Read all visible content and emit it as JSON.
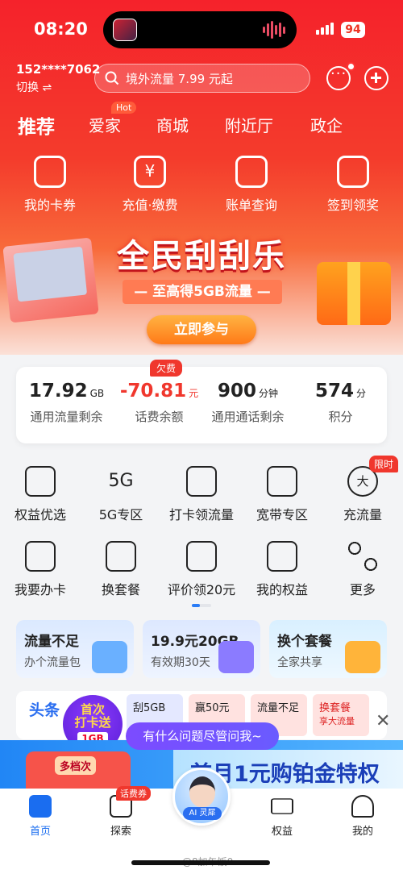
{
  "status": {
    "time": "08:20",
    "battery": "94"
  },
  "account": {
    "phone": "152****7062",
    "switch_label": "切换 ⇌"
  },
  "search": {
    "placeholder": "境外流量 7.99 元起"
  },
  "tabs": [
    {
      "label": "推荐"
    },
    {
      "label": "爱家",
      "badge": "Hot"
    },
    {
      "label": "商城"
    },
    {
      "label": "附近厅"
    },
    {
      "label": "政企"
    }
  ],
  "quick_actions": [
    {
      "label": "我的卡券",
      "icon": "coupon-icon"
    },
    {
      "label": "充值·缴费",
      "icon": "yen-icon"
    },
    {
      "label": "账单查询",
      "icon": "bill-search-icon"
    },
    {
      "label": "签到领奖",
      "icon": "calendar-check-icon"
    }
  ],
  "banner": {
    "title": "全民刮刮乐",
    "subtitle": "— 至高得5GB流量 —",
    "cta": "立即参与"
  },
  "stats": [
    {
      "value": "17.92",
      "unit": "GB",
      "label": "通用流量剩余"
    },
    {
      "value": "-70.81",
      "unit": "元",
      "label": "话费余额",
      "badge": "欠费"
    },
    {
      "value": "900",
      "unit": "分钟",
      "label": "通用通话剩余"
    },
    {
      "value": "574",
      "unit": "分",
      "label": "积分"
    }
  ],
  "services": [
    {
      "label": "权益优选",
      "icon": "shield-v-icon"
    },
    {
      "label": "5G专区",
      "icon": "5g-icon"
    },
    {
      "label": "打卡领流量",
      "icon": "sim-data-icon"
    },
    {
      "label": "宽带专区",
      "icon": "broadband-icon"
    },
    {
      "label": "充流量",
      "icon": "big-circle-icon",
      "badge": "限时"
    },
    {
      "label": "我要办卡",
      "icon": "sim-card-icon"
    },
    {
      "label": "换套餐",
      "icon": "discount-plan-icon"
    },
    {
      "label": "评价领20元",
      "icon": "edit-review-icon"
    },
    {
      "label": "我的权益",
      "icon": "bag-check-icon"
    },
    {
      "label": "更多",
      "icon": "more-grid-icon"
    }
  ],
  "promos": [
    {
      "title": "流量不足",
      "sub": "办个流量包"
    },
    {
      "title": "19.9元20GB",
      "sub": "有效期30天"
    },
    {
      "title": "换个套餐",
      "sub": "全家共享"
    }
  ],
  "news": {
    "head": "头条",
    "chips": [
      {
        "title": "刮5GB"
      },
      {
        "title": "赢50元"
      },
      {
        "title": "流量不足"
      },
      {
        "title": "换套餐",
        "sub": "享大流量"
      }
    ]
  },
  "checkin": {
    "line1": "首次",
    "line2": "打卡送",
    "gift": "1GB"
  },
  "assistant_bubble": "有什么问题尽管问我~",
  "ad": {
    "left_tag": "多档次",
    "right_text": "首月1元购铂金特权"
  },
  "nav": [
    {
      "label": "首页"
    },
    {
      "label": "探索",
      "badge": "话费券"
    },
    {
      "label": "AI 灵犀"
    },
    {
      "label": "权益"
    },
    {
      "label": "我的"
    }
  ],
  "watermark": "@8加午饭0",
  "colors": {
    "primary_red": "#f0372d",
    "accent_blue": "#1a6df0"
  }
}
